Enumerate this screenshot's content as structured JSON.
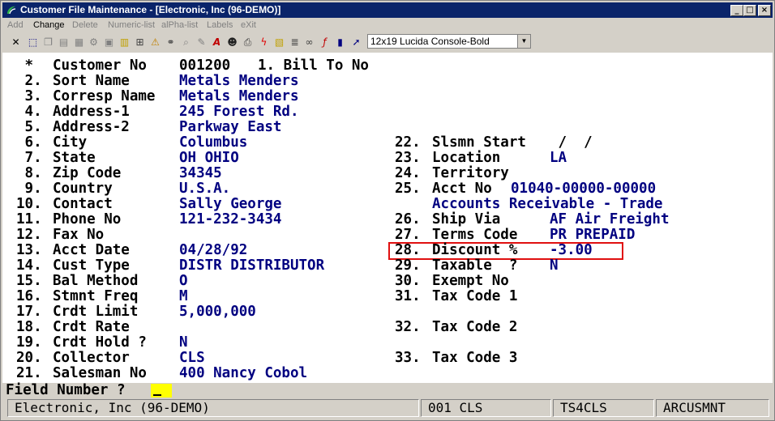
{
  "window": {
    "title": "Customer File Maintenance - [Electronic, Inc (96-DEMO)]",
    "controls": [
      "_",
      "□",
      "×"
    ]
  },
  "menu": {
    "items": [
      {
        "label": "Add",
        "enabled": false
      },
      {
        "label": "Change",
        "enabled": true
      },
      {
        "label": "Delete",
        "enabled": false
      },
      {
        "label": "Numeric-list",
        "enabled": false
      },
      {
        "label": "alPha-list",
        "enabled": false
      },
      {
        "label": "Labels",
        "enabled": false
      },
      {
        "label": "eXit",
        "enabled": false
      }
    ]
  },
  "toolbar": {
    "font_select": "12x19 Lucida Console-Bold",
    "icons": [
      "close-icon",
      "select-icon",
      "copy-icon",
      "paste-icon",
      "paste-special-icon",
      "settings-icon",
      "notepad-icon",
      "lookup-icon",
      "warning-icon",
      "zoom-icon",
      "binoculars-icon",
      "edit-icon",
      "font-icon",
      "user-icon",
      "flash-icon",
      "calc-icon",
      "link-icon",
      "function-icon",
      "book-icon",
      "pointer-help-icon"
    ]
  },
  "form": {
    "left": [
      {
        "num": " *",
        "label": "Customer No",
        "value": "001200",
        "extra": "1. Bill To No"
      },
      {
        "num": " 2.",
        "label": "Sort Name",
        "value": "Metals Menders"
      },
      {
        "num": " 3.",
        "label": "Corresp Name",
        "value": "Metals Menders"
      },
      {
        "num": " 4.",
        "label": "Address-1",
        "value": "245 Forest Rd."
      },
      {
        "num": " 5.",
        "label": "Address-2",
        "value": "Parkway East"
      },
      {
        "num": " 6.",
        "label": "City",
        "value": "Columbus"
      },
      {
        "num": " 7.",
        "label": "State",
        "value": "OH OHIO"
      },
      {
        "num": " 8.",
        "label": "Zip Code",
        "value": "34345"
      },
      {
        "num": " 9.",
        "label": "Country",
        "value": "U.S.A."
      },
      {
        "num": "10.",
        "label": "Contact",
        "value": "Sally George"
      },
      {
        "num": "11.",
        "label": "Phone No",
        "value": "121-232-3434"
      },
      {
        "num": "12.",
        "label": "Fax No",
        "value": ""
      },
      {
        "num": "13.",
        "label": "Acct Date",
        "value": "04/28/92"
      },
      {
        "num": "14.",
        "label": "Cust Type",
        "value": "DISTR DISTRIBUTOR"
      },
      {
        "num": "15.",
        "label": "Bal Method",
        "value": "O"
      },
      {
        "num": "16.",
        "label": "Stmnt Freq",
        "value": "M"
      },
      {
        "num": "17.",
        "label": "Crdt Limit",
        "value": "5,000,000"
      },
      {
        "num": "18.",
        "label": "Crdt Rate",
        "value": ""
      },
      {
        "num": "19.",
        "label": "Crdt Hold ?",
        "value": "N"
      },
      {
        "num": "20.",
        "label": "Collector",
        "value": "CLS"
      },
      {
        "num": "21.",
        "label": "Salesman No",
        "value": "400 Nancy Cobol"
      }
    ],
    "right": [
      {
        "row": 5,
        "num": "22.",
        "label": "Slsmn Start",
        "value": " /  /"
      },
      {
        "row": 6,
        "num": "23.",
        "label": "Location",
        "value": "LA"
      },
      {
        "row": 7,
        "num": "24.",
        "label": "Territory",
        "value": ""
      },
      {
        "row": 8,
        "num": "25.",
        "label": "Acct No",
        "value": "01040-00000-00000"
      },
      {
        "row": 9,
        "num": "",
        "label": "",
        "value": "Accounts Receivable - Trade"
      },
      {
        "row": 10,
        "num": "26.",
        "label": "Ship Via",
        "value": "AF Air Freight"
      },
      {
        "row": 11,
        "num": "27.",
        "label": "Terms Code",
        "value": "PR PREPAID"
      },
      {
        "row": 12,
        "num": "28.",
        "label": "Discount %",
        "value": "-3.00"
      },
      {
        "row": 13,
        "num": "29.",
        "label": "Taxable  ?",
        "value": "N"
      },
      {
        "row": 14,
        "num": "30.",
        "label": "Exempt No",
        "value": ""
      },
      {
        "row": 15,
        "num": "31.",
        "label": "Tax Code 1",
        "value": ""
      },
      {
        "row": 17,
        "num": "32.",
        "label": "Tax Code 2",
        "value": ""
      },
      {
        "row": 19,
        "num": "33.",
        "label": "Tax Code 3",
        "value": ""
      }
    ]
  },
  "prompt": {
    "label": "Field Number ?",
    "value": "_"
  },
  "status": {
    "company": "Electronic, Inc (96-DEMO)",
    "user": "001 CLS",
    "terminal": "TS4CLS",
    "program": "ARCUSMNT"
  }
}
